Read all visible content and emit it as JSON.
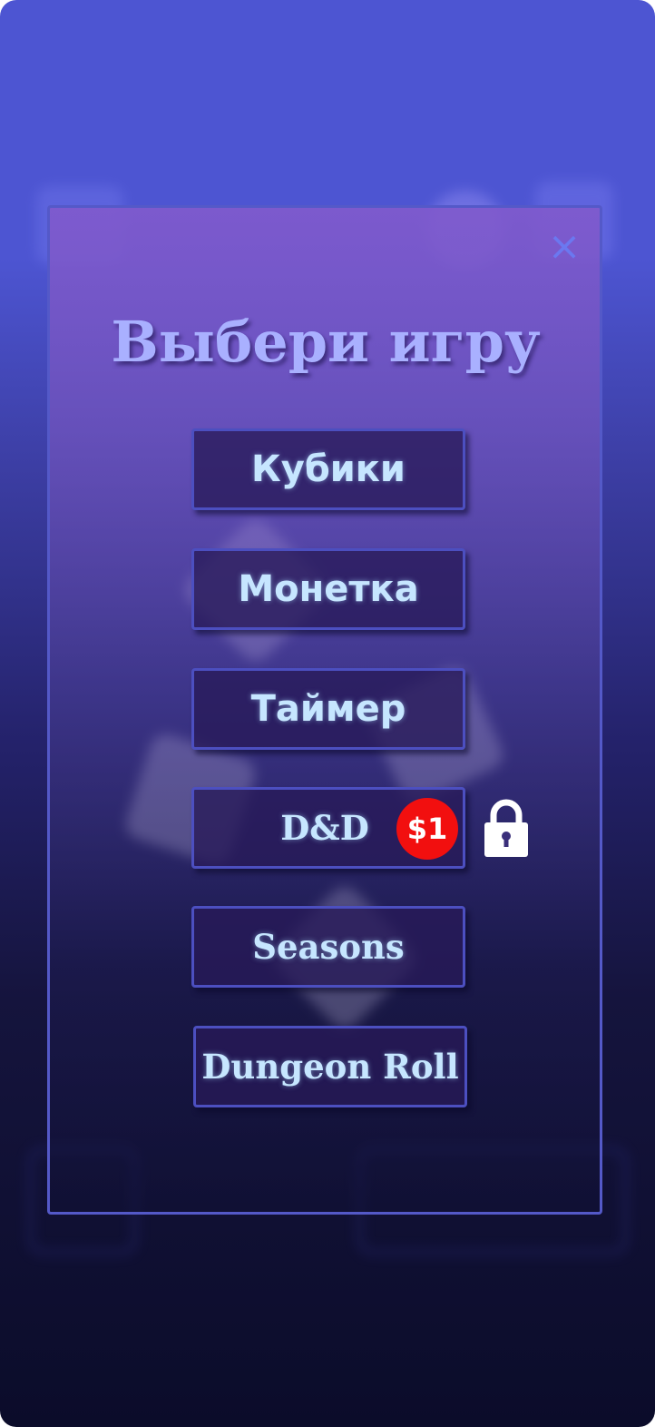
{
  "dialog": {
    "title": "Выбери игру",
    "close_icon": "×"
  },
  "menu": {
    "items": [
      {
        "label": "Кубики"
      },
      {
        "label": "Монетка"
      },
      {
        "label": "Таймер"
      },
      {
        "label": "D&D",
        "price": "$1",
        "locked": true
      },
      {
        "label": "Seasons"
      },
      {
        "label": "Dungeon Roll"
      }
    ]
  },
  "icons": {
    "close": "close-icon",
    "lock": "lock-icon"
  },
  "colors": {
    "title": "#a9b0ff",
    "button_text": "#c6e6ff",
    "price_badge": "#f20f0f",
    "close_icon": "#6b78f0",
    "border": "#4c4fc0"
  }
}
